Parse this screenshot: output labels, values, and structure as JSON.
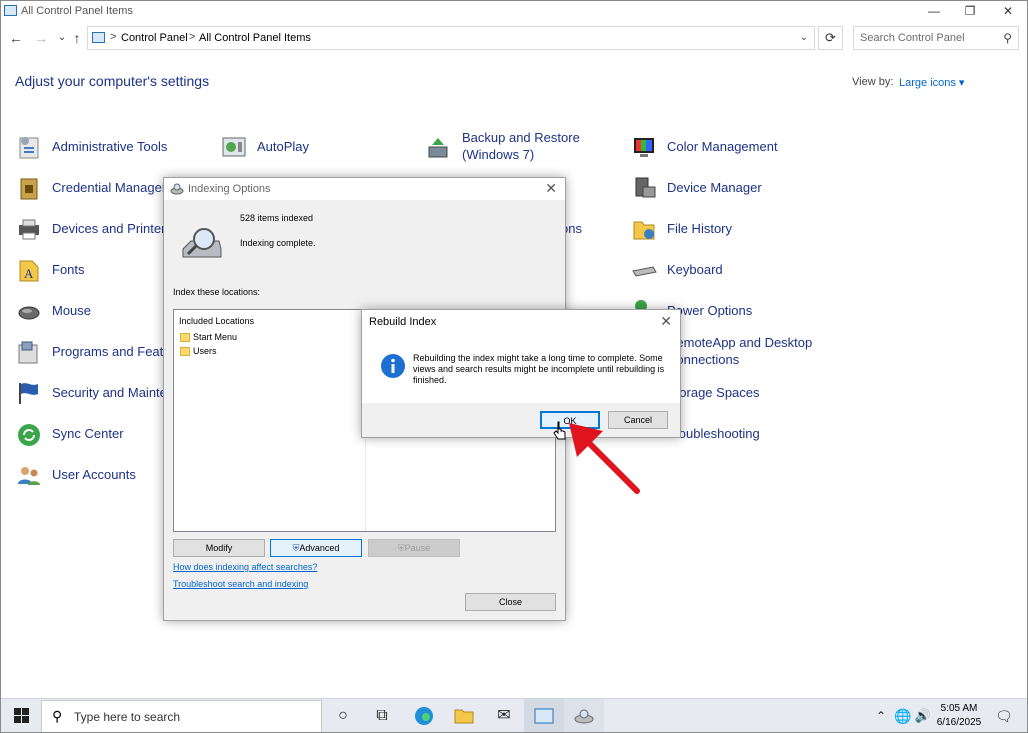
{
  "window": {
    "title": "All Control Panel Items",
    "minimize": "—",
    "restore": "❐",
    "close": "✕"
  },
  "nav": {
    "back": "←",
    "forward": "→",
    "recent": "⌄",
    "up": "↑",
    "breadcrumb": [
      "Control Panel",
      "All Control Panel Items"
    ],
    "separator": ">",
    "refresh": "⟳",
    "search_placeholder": "Search Control Panel"
  },
  "main": {
    "heading": "Adjust your computer's settings",
    "view_by_label": "View by:",
    "view_by_value": "Large icons ▾"
  },
  "items": {
    "col1": [
      "Administrative Tools",
      "Credential Manager",
      "Devices and Printers",
      "Fonts",
      "Mouse",
      "Programs and Features",
      "Security and Maintenance",
      "Sync Center",
      "User Accounts"
    ],
    "col2": [
      "AutoPlay"
    ],
    "col3": [
      "Backup and Restore",
      "(Windows 7)",
      "ons"
    ],
    "col4": [
      "Color Management",
      "Device Manager",
      "File History",
      "Keyboard",
      "Power Options",
      "RemoteApp and Desktop",
      "Connections",
      "Storage Spaces",
      "Troubleshooting"
    ]
  },
  "indexing": {
    "title": "Indexing Options",
    "close": "✕",
    "count": "528 items indexed",
    "status": "Indexing complete.",
    "locations_label": "Index these locations:",
    "list_header": "Included Locations",
    "locations": [
      "Start Menu",
      "Users"
    ],
    "modify": "Modify",
    "advanced": "Advanced",
    "pause": "Pause",
    "link1": "How does indexing affect searches?",
    "link2": "Troubleshoot search and indexing",
    "close_button": "Close"
  },
  "rebuild": {
    "title": "Rebuild Index",
    "close": "✕",
    "message": "Rebuilding the index might take a long time to complete. Some views and search results might be incomplete until rebuilding is finished.",
    "ok": "OK",
    "cancel": "Cancel"
  },
  "taskbar": {
    "search_placeholder": "Type here to search",
    "time": "5:05 AM",
    "date": "6/16/2025"
  },
  "colors": {
    "link_blue": "#1e3287",
    "accent": "#0078d7",
    "arrow_red": "#e0141e"
  }
}
